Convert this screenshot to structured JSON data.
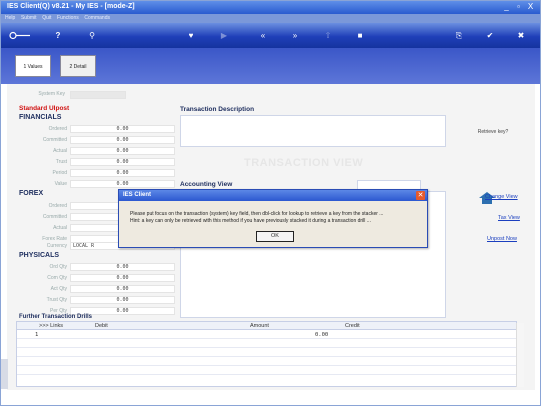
{
  "window": {
    "title": "IES Client(Q) v8.21 - My IES -        [mode-Z]",
    "controls": {
      "minimize": "_",
      "maximize": "▫",
      "close": "X"
    }
  },
  "menu": [
    "Help",
    "Submit",
    "Quit",
    "Functions",
    "Commands"
  ],
  "tabs": [
    {
      "label": "1 Values"
    },
    {
      "label": "2 Detail"
    }
  ],
  "main": {
    "system_key_label": "System Key",
    "standard_label": "Standard UIpost",
    "financials": {
      "title": "FINANCIALS",
      "rows": [
        {
          "label": "Ordered",
          "value": "0.00"
        },
        {
          "label": "Committed",
          "value": "0.00"
        },
        {
          "label": "Actual",
          "value": "0.00"
        },
        {
          "label": "Trust",
          "value": "0.00"
        },
        {
          "label": "Period",
          "value": "0.00"
        },
        {
          "label": "Value",
          "value": "0.00"
        }
      ]
    },
    "forex": {
      "title": "FOREX",
      "rows": [
        {
          "label": "Ordered",
          "value": ""
        },
        {
          "label": "Committed",
          "value": ""
        },
        {
          "label": "Actual",
          "value": ""
        },
        {
          "label": "Forex Rate",
          "value": ""
        },
        {
          "label": "Currency",
          "value": "LOCAL R"
        }
      ]
    },
    "physicals": {
      "title": "PHYSICALS",
      "rows": [
        {
          "label": "Ord Qty",
          "value": "0.00"
        },
        {
          "label": "Com Qty",
          "value": "0.00"
        },
        {
          "label": "Act Qty",
          "value": "0.00"
        },
        {
          "label": "Trust Qty",
          "value": "0.00"
        },
        {
          "label": "Per Qty",
          "value": "0.00"
        }
      ]
    },
    "transaction_description_label": "Transaction Description",
    "watermark": "TRANSACTION VIEW",
    "accounting_view_label": "Accounting View",
    "retrieve_key_label": "Retrieve key?",
    "links": [
      "Change View",
      "Tax View",
      "Unpost Now"
    ],
    "further_drills_title": "Further Transaction Drills"
  },
  "grid": {
    "columns": [
      ">>> Links",
      "Debit",
      "Amount",
      "Credit"
    ],
    "rows": [
      {
        "index": "1",
        "amount": "0.00"
      }
    ]
  },
  "dialog": {
    "title": "IES Client",
    "message_line1": "Please put focus on the transaction (system) key field, then dbl-click for lookup to retrieve a key from the stacker ...",
    "message_line2": "Hint: a key can only be retrieved with this method if you have previously stacked it during a transaction drill ...",
    "ok_label": "OK"
  },
  "colors": {
    "title_bar": "#2a5bcf",
    "toolbar": "#1f3fb8",
    "tabstrip": "#3b57c8",
    "accent_red": "#d01010",
    "link_blue": "#1b3fbf"
  },
  "icons": [
    "key-icon",
    "help-icon",
    "search-icon",
    "heart-icon",
    "back-icon",
    "rewind-icon",
    "forward-icon",
    "export-icon",
    "stop-icon",
    "print-icon",
    "check-icon",
    "close-icon",
    "house-icon"
  ]
}
